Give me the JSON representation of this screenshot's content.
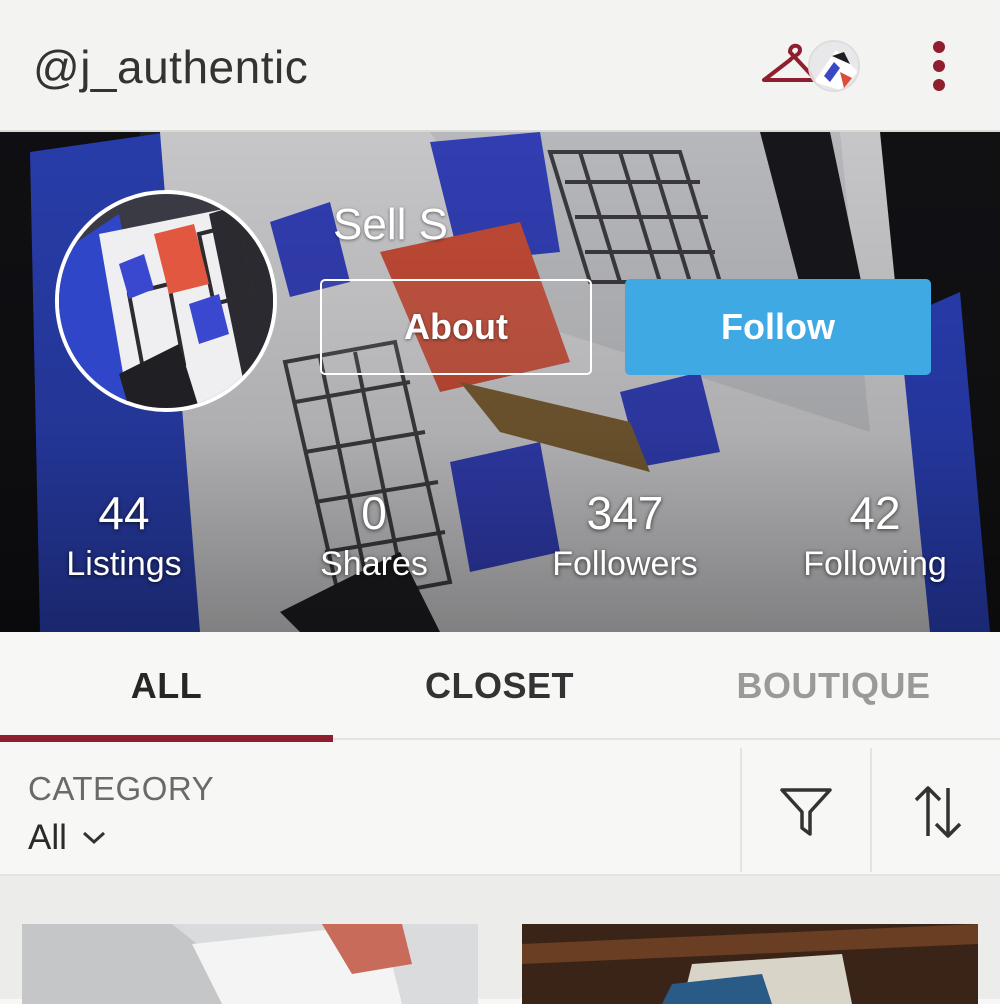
{
  "header": {
    "username": "@j_authentic",
    "icons": [
      "hanger-icon",
      "closet-avatar",
      "more-vert-icon"
    ],
    "accent_color": "#8f1f2f"
  },
  "profile": {
    "display_name": "Sell S",
    "about_label": "About",
    "follow_label": "Follow",
    "follow_color": "#3fa9e4"
  },
  "stats": [
    {
      "value": "44",
      "label": "Listings"
    },
    {
      "value": "0",
      "label": "Shares"
    },
    {
      "value": "347",
      "label": "Followers"
    },
    {
      "value": "42",
      "label": "Following"
    }
  ],
  "tabs": [
    {
      "label": "ALL",
      "active": true
    },
    {
      "label": "CLOSET",
      "active": false
    },
    {
      "label": "BOUTIQUE",
      "active": false
    }
  ],
  "filters": {
    "category_label": "CATEGORY",
    "category_value": "All",
    "icons": [
      "filter-icon",
      "sort-icon"
    ]
  }
}
